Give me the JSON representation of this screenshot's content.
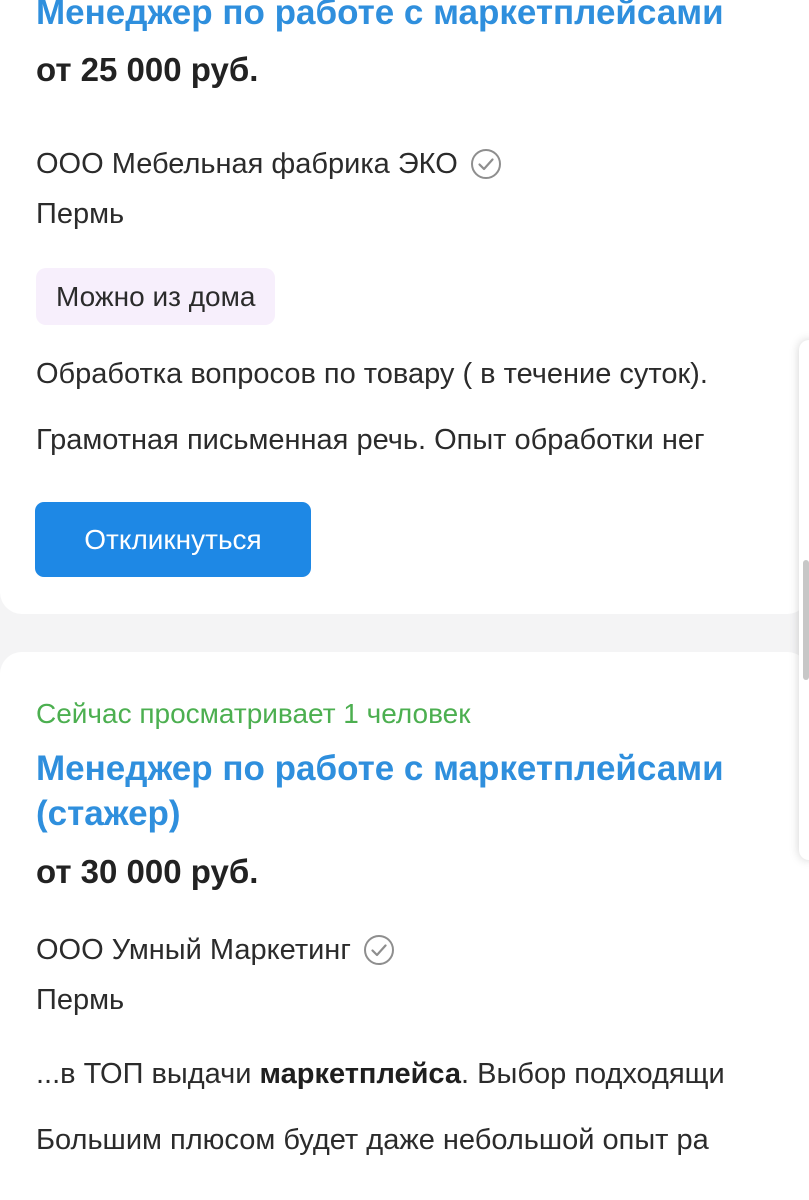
{
  "vacancies": [
    {
      "title": "Менеджер по работе с маркетплейсами",
      "salary": "от 25 000 руб.",
      "company": "ООО Мебельная фабрика ЭКО",
      "company_verified_icon": "check-circle-icon",
      "city": "Пермь",
      "tag": "Можно из дома",
      "snippet_1": "Обработка вопросов по товару ( в течение суток).",
      "snippet_2": "Грамотная письменная речь. Опыт обработки нег",
      "respond_label": "Откликнуться"
    },
    {
      "viewers": "Сейчас просматривает 1 человек",
      "title_line_1": "Менеджер по работе с маркетплейсами",
      "title_line_2": "(стажер)",
      "salary": "от 30 000 руб.",
      "company": "ООО Умный Маркетинг",
      "company_verified_icon": "check-circle-icon",
      "city": "Пермь",
      "snippet_1_prefix": "...в ТОП выдачи ",
      "snippet_1_bold": "маркетплейса",
      "snippet_1_suffix": ". Выбор подходящи",
      "snippet_2": "Большим плюсом будет даже небольшой опыт ра"
    }
  ],
  "colors": {
    "title": "#2f8fdd",
    "button": "#1e88e5",
    "viewers": "#4caf50",
    "tag_bg": "#f7effc",
    "page_bg": "#f4f4f5"
  }
}
